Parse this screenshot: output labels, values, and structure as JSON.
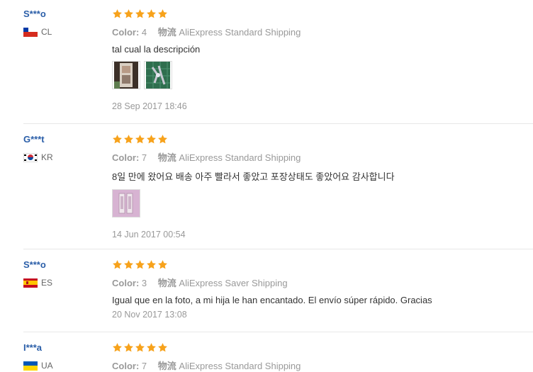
{
  "reviews": [
    {
      "user": "S***o",
      "country": "CL",
      "color_label": "Color:",
      "color_value": "4",
      "logistics_label": "物流",
      "shipping": "AliExpress Standard Shipping",
      "text": "tal cual la descripción",
      "photos": 2,
      "date": "28 Sep 2017 18:46"
    },
    {
      "user": "G***t",
      "country": "KR",
      "color_label": "Color:",
      "color_value": "7",
      "logistics_label": "物流",
      "shipping": "AliExpress Standard Shipping",
      "text": "8일 만에 왔어요 배송 아주 빨라서 좋았고 포장상태도 좋았어요 감사합니다",
      "photos": 1,
      "date": "14 Jun 2017 00:54"
    },
    {
      "user": "S***o",
      "country": "ES",
      "color_label": "Color:",
      "color_value": "3",
      "logistics_label": "物流",
      "shipping": "AliExpress Saver Shipping",
      "text": "Igual que en la foto, a mi hija le han encantado. El envío súper rápido. Gracias",
      "photos": 0,
      "date": "20 Nov 2017 13:08"
    },
    {
      "user": "I***a",
      "country": "UA",
      "color_label": "Color:",
      "color_value": "7",
      "logistics_label": "物流",
      "shipping": "AliExpress Standard Shipping",
      "text": "",
      "photos": 0,
      "date": ""
    }
  ],
  "rating_stars": 5,
  "star_color": "#f7a21b",
  "user_color": "#2a5ea8"
}
